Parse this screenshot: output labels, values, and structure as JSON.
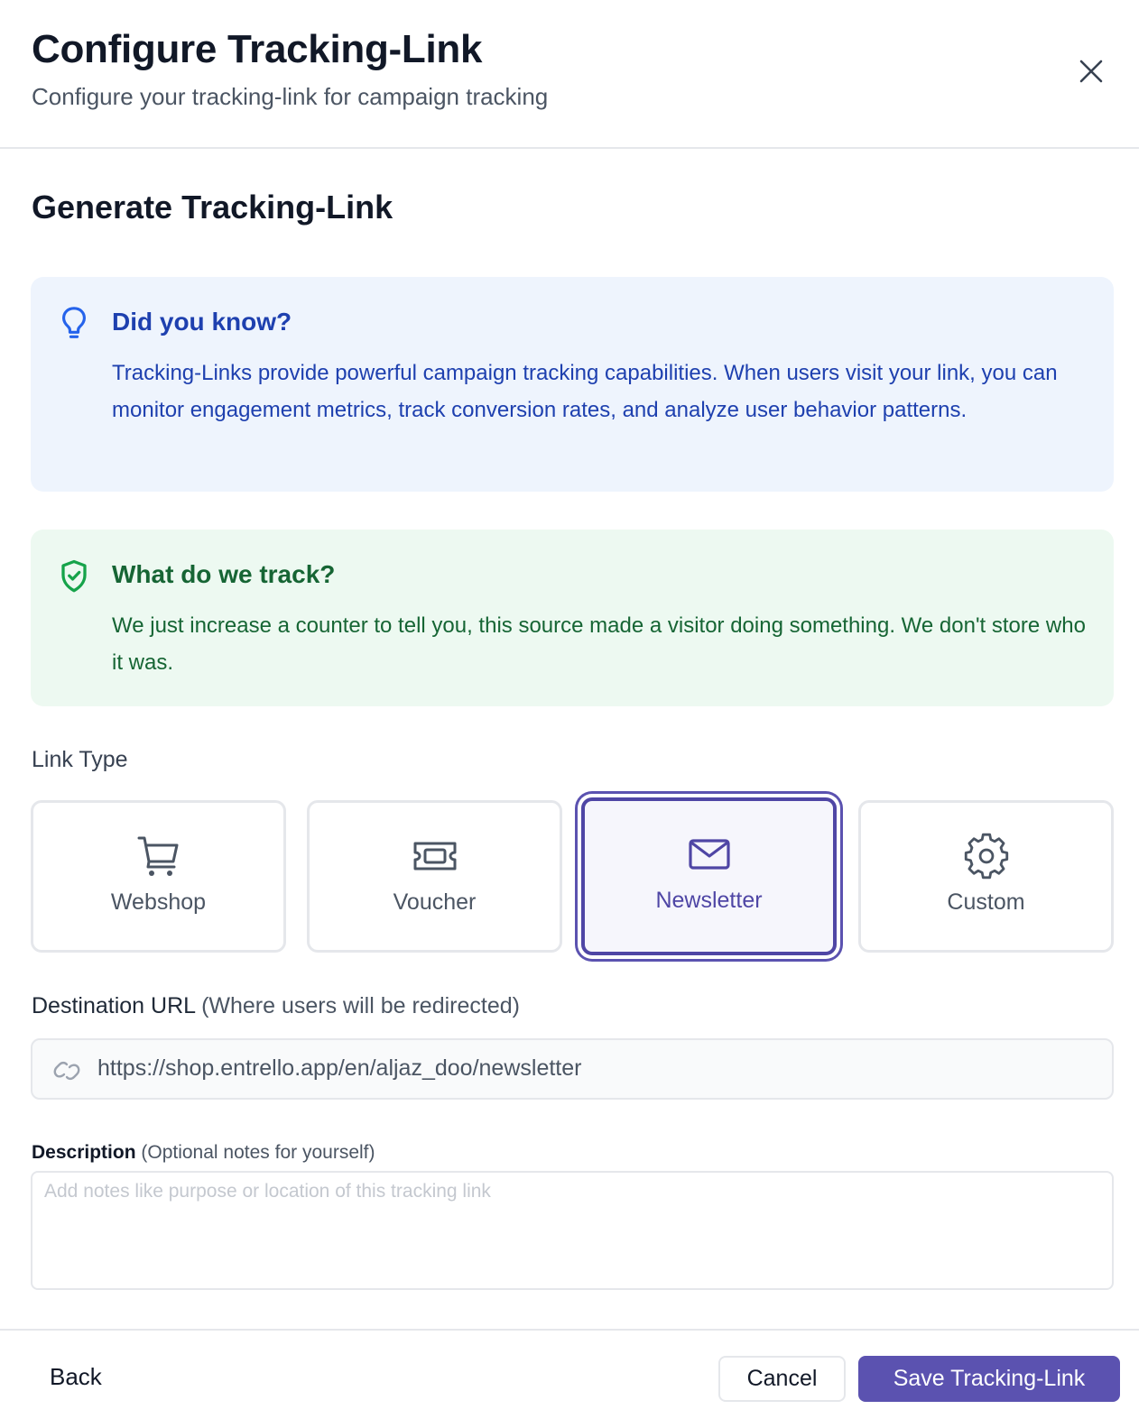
{
  "header": {
    "title": "Configure Tracking-Link",
    "subtitle": "Configure your tracking-link for campaign tracking",
    "close_icon": "close-icon"
  },
  "section_title": "Generate Tracking-Link",
  "info_callout": {
    "icon": "lightbulb-icon",
    "heading": "Did you know?",
    "body": "Tracking-Links provide powerful campaign tracking capabilities. When users visit your link, you can monitor engagement metrics, track conversion rates, and analyze user behavior patterns.",
    "color": "#1e40af",
    "background": "#eef4fd"
  },
  "privacy_callout": {
    "icon": "shield-check-icon",
    "heading": "What do we track?",
    "body": "We just increase a counter to tell you, this source made a visitor doing something. We don't store who it was.",
    "color": "#166534",
    "background": "#edf9f1"
  },
  "link_type": {
    "label": "Link Type",
    "selected": "Newsletter",
    "options": [
      {
        "label": "Webshop",
        "icon": "shopping-cart-icon"
      },
      {
        "label": "Voucher",
        "icon": "ticket-icon"
      },
      {
        "label": "Newsletter",
        "icon": "mail-icon"
      },
      {
        "label": "Custom",
        "icon": "gear-icon"
      }
    ]
  },
  "destination_url": {
    "label": "Destination URL",
    "hint": "(Where users will be redirected)",
    "icon": "link-icon",
    "value": "https://shop.entrello.app/en/aljaz_doo/newsletter"
  },
  "description": {
    "label": "Description",
    "hint": "(Optional notes for yourself)",
    "placeholder": "Add notes like purpose or location of this tracking link",
    "value": ""
  },
  "footer": {
    "back_label": "Back",
    "cancel_label": "Cancel",
    "save_label": "Save Tracking-Link"
  },
  "colors": {
    "accent": "#5b52b0",
    "accent_dark": "#4f46a5"
  }
}
